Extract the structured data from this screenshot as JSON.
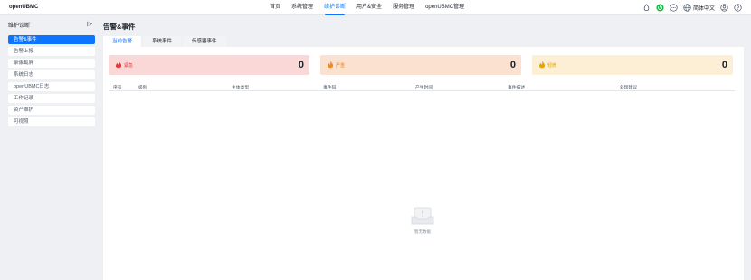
{
  "app": {
    "logo": "openUBMC"
  },
  "nav": {
    "items": [
      {
        "label": "首页"
      },
      {
        "label": "系统管理"
      },
      {
        "label": "维护诊断"
      },
      {
        "label": "用户&安全"
      },
      {
        "label": "服务管理"
      },
      {
        "label": "openUBMC管理"
      }
    ],
    "active_index": 2
  },
  "topbar": {
    "language": "简体中文",
    "icons": [
      "alarm-icon",
      "power-icon",
      "dots-icon",
      "globe-icon",
      "user-icon",
      "help-icon"
    ],
    "power_color": "#26b24b"
  },
  "sidebar": {
    "title": "维护诊断",
    "items": [
      {
        "label": "告警&事件"
      },
      {
        "label": "告警上报"
      },
      {
        "label": "录像截屏"
      },
      {
        "label": "系统日志"
      },
      {
        "label": "openUBMC日志"
      },
      {
        "label": "工作记录"
      },
      {
        "label": "资产维护"
      },
      {
        "label": "可视照"
      }
    ],
    "active_index": 0
  },
  "main": {
    "title": "告警&事件",
    "tabs": [
      {
        "label": "当前告警"
      },
      {
        "label": "系统事件"
      },
      {
        "label": "传感器事件"
      }
    ],
    "active_tab": 0,
    "severity_cards": [
      {
        "label": "紧急",
        "count": "0",
        "color": "#e5363b"
      },
      {
        "label": "严重",
        "count": "0",
        "color": "#f08a24"
      },
      {
        "label": "轻微",
        "count": "0",
        "color": "#e6a400"
      }
    ],
    "table": {
      "columns": [
        "序号",
        "级别",
        "主体类型",
        "事件码",
        "产生时间",
        "事件描述",
        "处理建议"
      ]
    },
    "empty_text": "暂无数据"
  },
  "colors": {
    "accent": "#0c74ff",
    "background": "#eef0f4"
  }
}
